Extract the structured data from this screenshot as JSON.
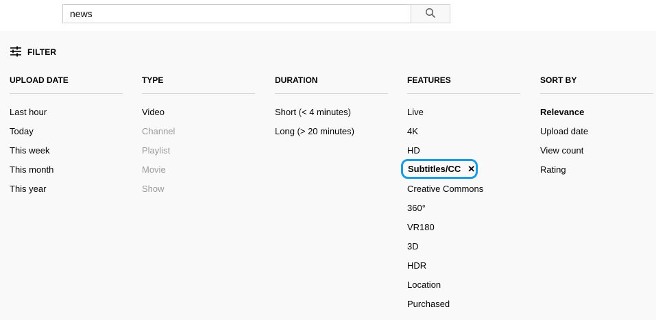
{
  "search": {
    "query": "news",
    "button_icon": "search-icon"
  },
  "filter": {
    "label": "FILTER",
    "icon": "tune-icon"
  },
  "columns": [
    {
      "header": "UPLOAD DATE",
      "options": [
        {
          "label": "Last hour",
          "state": "enabled"
        },
        {
          "label": "Today",
          "state": "enabled"
        },
        {
          "label": "This week",
          "state": "enabled"
        },
        {
          "label": "This month",
          "state": "enabled"
        },
        {
          "label": "This year",
          "state": "enabled"
        }
      ]
    },
    {
      "header": "TYPE",
      "options": [
        {
          "label": "Video",
          "state": "enabled"
        },
        {
          "label": "Channel",
          "state": "disabled"
        },
        {
          "label": "Playlist",
          "state": "disabled"
        },
        {
          "label": "Movie",
          "state": "disabled"
        },
        {
          "label": "Show",
          "state": "disabled"
        }
      ]
    },
    {
      "header": "DURATION",
      "options": [
        {
          "label": "Short (< 4 minutes)",
          "state": "enabled"
        },
        {
          "label": "Long (> 20 minutes)",
          "state": "enabled"
        }
      ]
    },
    {
      "header": "FEATURES",
      "options": [
        {
          "label": "Live",
          "state": "enabled"
        },
        {
          "label": "4K",
          "state": "enabled"
        },
        {
          "label": "HD",
          "state": "enabled"
        },
        {
          "label": "Subtitles/CC",
          "state": "selected",
          "remove_glyph": "✕"
        },
        {
          "label": "Creative Commons",
          "state": "enabled"
        },
        {
          "label": "360°",
          "state": "enabled"
        },
        {
          "label": "VR180",
          "state": "enabled"
        },
        {
          "label": "3D",
          "state": "enabled"
        },
        {
          "label": "HDR",
          "state": "enabled"
        },
        {
          "label": "Location",
          "state": "enabled"
        },
        {
          "label": "Purchased",
          "state": "enabled"
        }
      ]
    },
    {
      "header": "SORT BY",
      "options": [
        {
          "label": "Relevance",
          "state": "active"
        },
        {
          "label": "Upload date",
          "state": "enabled"
        },
        {
          "label": "View count",
          "state": "enabled"
        },
        {
          "label": "Rating",
          "state": "enabled"
        }
      ]
    }
  ],
  "colors": {
    "accent_highlight": "#1a9ddf",
    "disabled_text": "#9a9a9a",
    "background": "#f9f9f9"
  }
}
